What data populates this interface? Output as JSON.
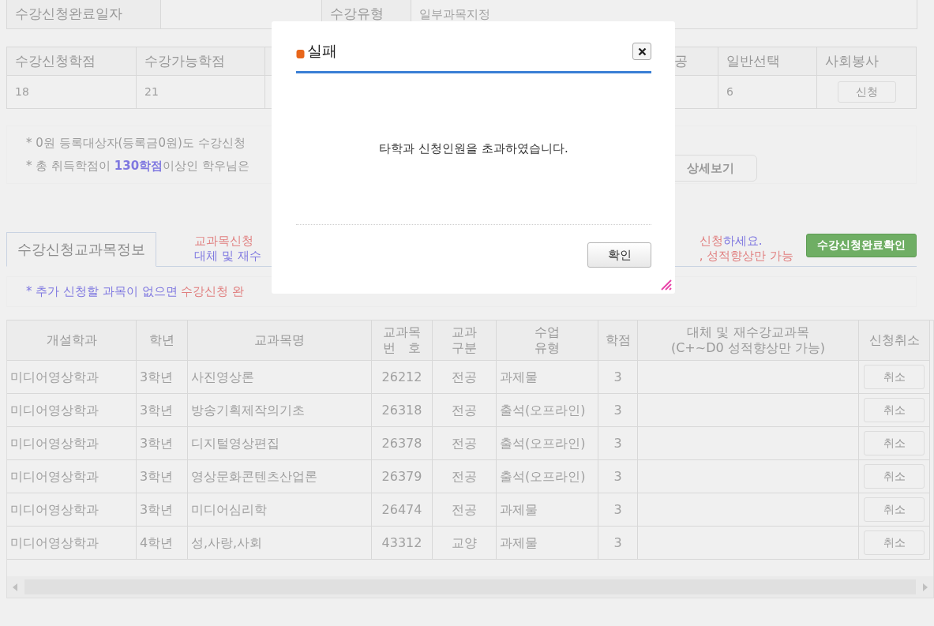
{
  "info": {
    "date_label": "수강신청완료일자",
    "type_label": "수강유형",
    "type_value": "일부과목지정"
  },
  "credits": [
    {
      "label": "수강신청학점",
      "value": "18"
    },
    {
      "label": "수강가능학점",
      "value": "21"
    },
    {
      "label": "공"
    },
    {
      "label": "일반선택",
      "value": "6"
    },
    {
      "label": "사회봉사",
      "button": "신청"
    }
  ],
  "notices": [
    [
      {
        "text": "* 0원 등록대상자(등록금0원)도 수강신청",
        "color": "#9c9c9c",
        "bold": false
      }
    ],
    [
      {
        "text": "* 총 취득학점이 ",
        "color": "#9c9c9c",
        "bold": false
      },
      {
        "text": "130학점",
        "color": "#7f78e0",
        "bold": true
      },
      {
        "text": "이상인 학우님은",
        "color": "#9c9c9c",
        "bold": false
      }
    ]
  ],
  "detail_button": "상세보기",
  "course_tab": {
    "label": "수강신청교과목정보",
    "selected": true
  },
  "guide_left": [
    [
      {
        "text": "교과목신청",
        "color": "#e07f7f",
        "bold": false
      }
    ],
    [
      {
        "text": "대체 및 재수",
        "color": "#7f78e0",
        "bold": false
      }
    ]
  ],
  "guide_right": [
    [
      {
        "text": "신청",
        "color": "#e07f7f",
        "bold": false
      },
      {
        "text": "하세요.",
        "color": "#7f78e0",
        "bold": false
      }
    ],
    [
      {
        "text": ", 성적향상만 가능",
        "color": "#e07f7f",
        "bold": false
      }
    ]
  ],
  "complete_button": "수강신청완료확인",
  "hint": [
    {
      "text": "* 추가 신청할 과목이 없으면 ",
      "color": "#7f78e0",
      "bold": false
    },
    {
      "text": "수강신청 완",
      "color": "#e07f7f",
      "bold": false
    }
  ],
  "table": {
    "columns": [
      "개설학과",
      "학년",
      "교과목명",
      "교과목\n번　호",
      "교과\n구분",
      "수업\n유형",
      "학점",
      "대체 및 재수강교과목\n(C+~D0 성적향상만 가능)",
      "신청취소"
    ],
    "rows": [
      {
        "cells": [
          "미디어영상학과",
          "3학년",
          "사진영상론",
          "26212",
          "전공",
          "과제물",
          "3"
        ],
        "cancel": "취소"
      },
      {
        "cells": [
          "미디어영상학과",
          "3학년",
          "방송기획제작의기초",
          "26318",
          "전공",
          "출석(오프라인)",
          "3"
        ],
        "cancel": "취소"
      },
      {
        "cells": [
          "미디어영상학과",
          "3학년",
          "디지털영상편집",
          "26378",
          "전공",
          "출석(오프라인)",
          "3"
        ],
        "cancel": "취소"
      },
      {
        "cells": [
          "미디어영상학과",
          "3학년",
          "영상문화콘텐츠산업론",
          "26379",
          "전공",
          "출석(오프라인)",
          "3"
        ],
        "cancel": "취소"
      },
      {
        "cells": [
          "미디어영상학과",
          "3학년",
          "미디어심리학",
          "26474",
          "전공",
          "과제물",
          "3"
        ],
        "cancel": "취소"
      },
      {
        "cells": [
          "미디어영상학과",
          "4학년",
          "성,사랑,사회",
          "43312",
          "교양",
          "과제물",
          "3"
        ],
        "cancel": "취소"
      }
    ]
  },
  "dialog": {
    "title": "실패",
    "message": "타학과 신청인원을 초과하였습니다.",
    "ok": "확인"
  }
}
